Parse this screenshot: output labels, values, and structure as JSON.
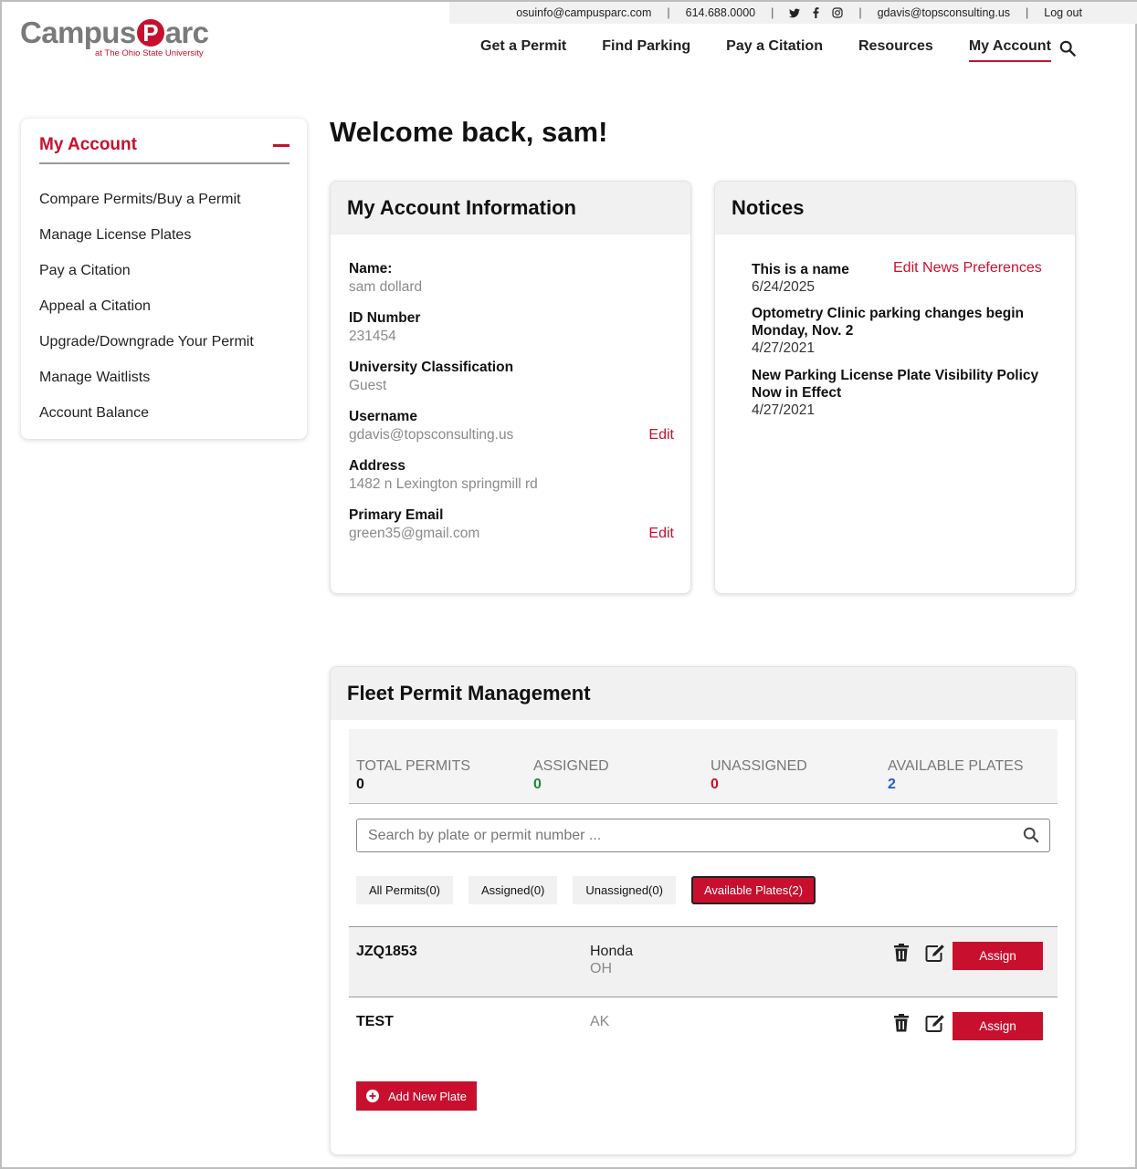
{
  "utility": {
    "email": "osuinfo@campusparc.com",
    "phone": "614.688.0000",
    "social": [
      "twitter-icon",
      "facebook-icon",
      "instagram-icon"
    ],
    "user": "gdavis@topsconsulting.us",
    "logout": "Log out",
    "separator": "|"
  },
  "logo": {
    "campus": "Campus",
    "p": "P",
    "arc": "arc",
    "sub": "at The Ohio State University"
  },
  "nav": {
    "items": [
      "Get a Permit",
      "Find Parking",
      "Pay a Citation",
      "Resources",
      "My Account"
    ],
    "active": "My Account"
  },
  "sidebar": {
    "title": "My Account",
    "items": [
      "Compare Permits/Buy a Permit",
      "Manage License Plates",
      "Pay a Citation",
      "Appeal a Citation",
      "Upgrade/Downgrade Your Permit",
      "Manage Waitlists",
      "Account Balance"
    ]
  },
  "welcome": "Welcome back, sam!",
  "account": {
    "title": "My Account Information",
    "fields": [
      {
        "label": "Name:",
        "value": "sam dollard"
      },
      {
        "label": "ID Number",
        "value": "231454"
      },
      {
        "label": "University Classification",
        "value": "Guest"
      },
      {
        "label": "Username",
        "value": "gdavis@topsconsulting.us",
        "edit": "Edit"
      },
      {
        "label": "Address",
        "value": "1482 n Lexington springmill rd"
      },
      {
        "label": "Primary Email",
        "value": "green35@gmail.com",
        "edit": "Edit"
      }
    ]
  },
  "notices": {
    "title": "Notices",
    "preferences": "Edit News Preferences",
    "items": [
      {
        "title": "This is a name",
        "date": "6/24/2025"
      },
      {
        "title": "Optometry Clinic parking changes begin Monday, Nov. 2",
        "date": "4/27/2021"
      },
      {
        "title": "New Parking License Plate Visibility Policy Now in Effect",
        "date": "4/27/2021"
      }
    ]
  },
  "fleet": {
    "title": "Fleet Permit Management",
    "stats": [
      {
        "label": "TOTAL PERMITS",
        "value": "0",
        "color": "#111111"
      },
      {
        "label": "ASSIGNED",
        "value": "0",
        "color": "#1a8a3a"
      },
      {
        "label": "UNASSIGNED",
        "value": "0",
        "color": "#c8102e"
      },
      {
        "label": "AVAILABLE PLATES",
        "value": "2",
        "color": "#1e5bd6"
      }
    ],
    "search_placeholder": "Search by plate or permit number ...",
    "filters": [
      "All Permits(0)",
      "Assigned(0)",
      "Unassigned(0)",
      "Available Plates(2)"
    ],
    "active_filter": 3,
    "plates": [
      {
        "plate": "JZQ1853",
        "make": "Honda",
        "state": "OH"
      },
      {
        "plate": "TEST",
        "make": "",
        "state": "AK"
      }
    ],
    "assign_label": "Assign",
    "add_label": "Add New Plate"
  },
  "colors": {
    "accent": "#c8102e",
    "panel": "#f1f1f1"
  }
}
